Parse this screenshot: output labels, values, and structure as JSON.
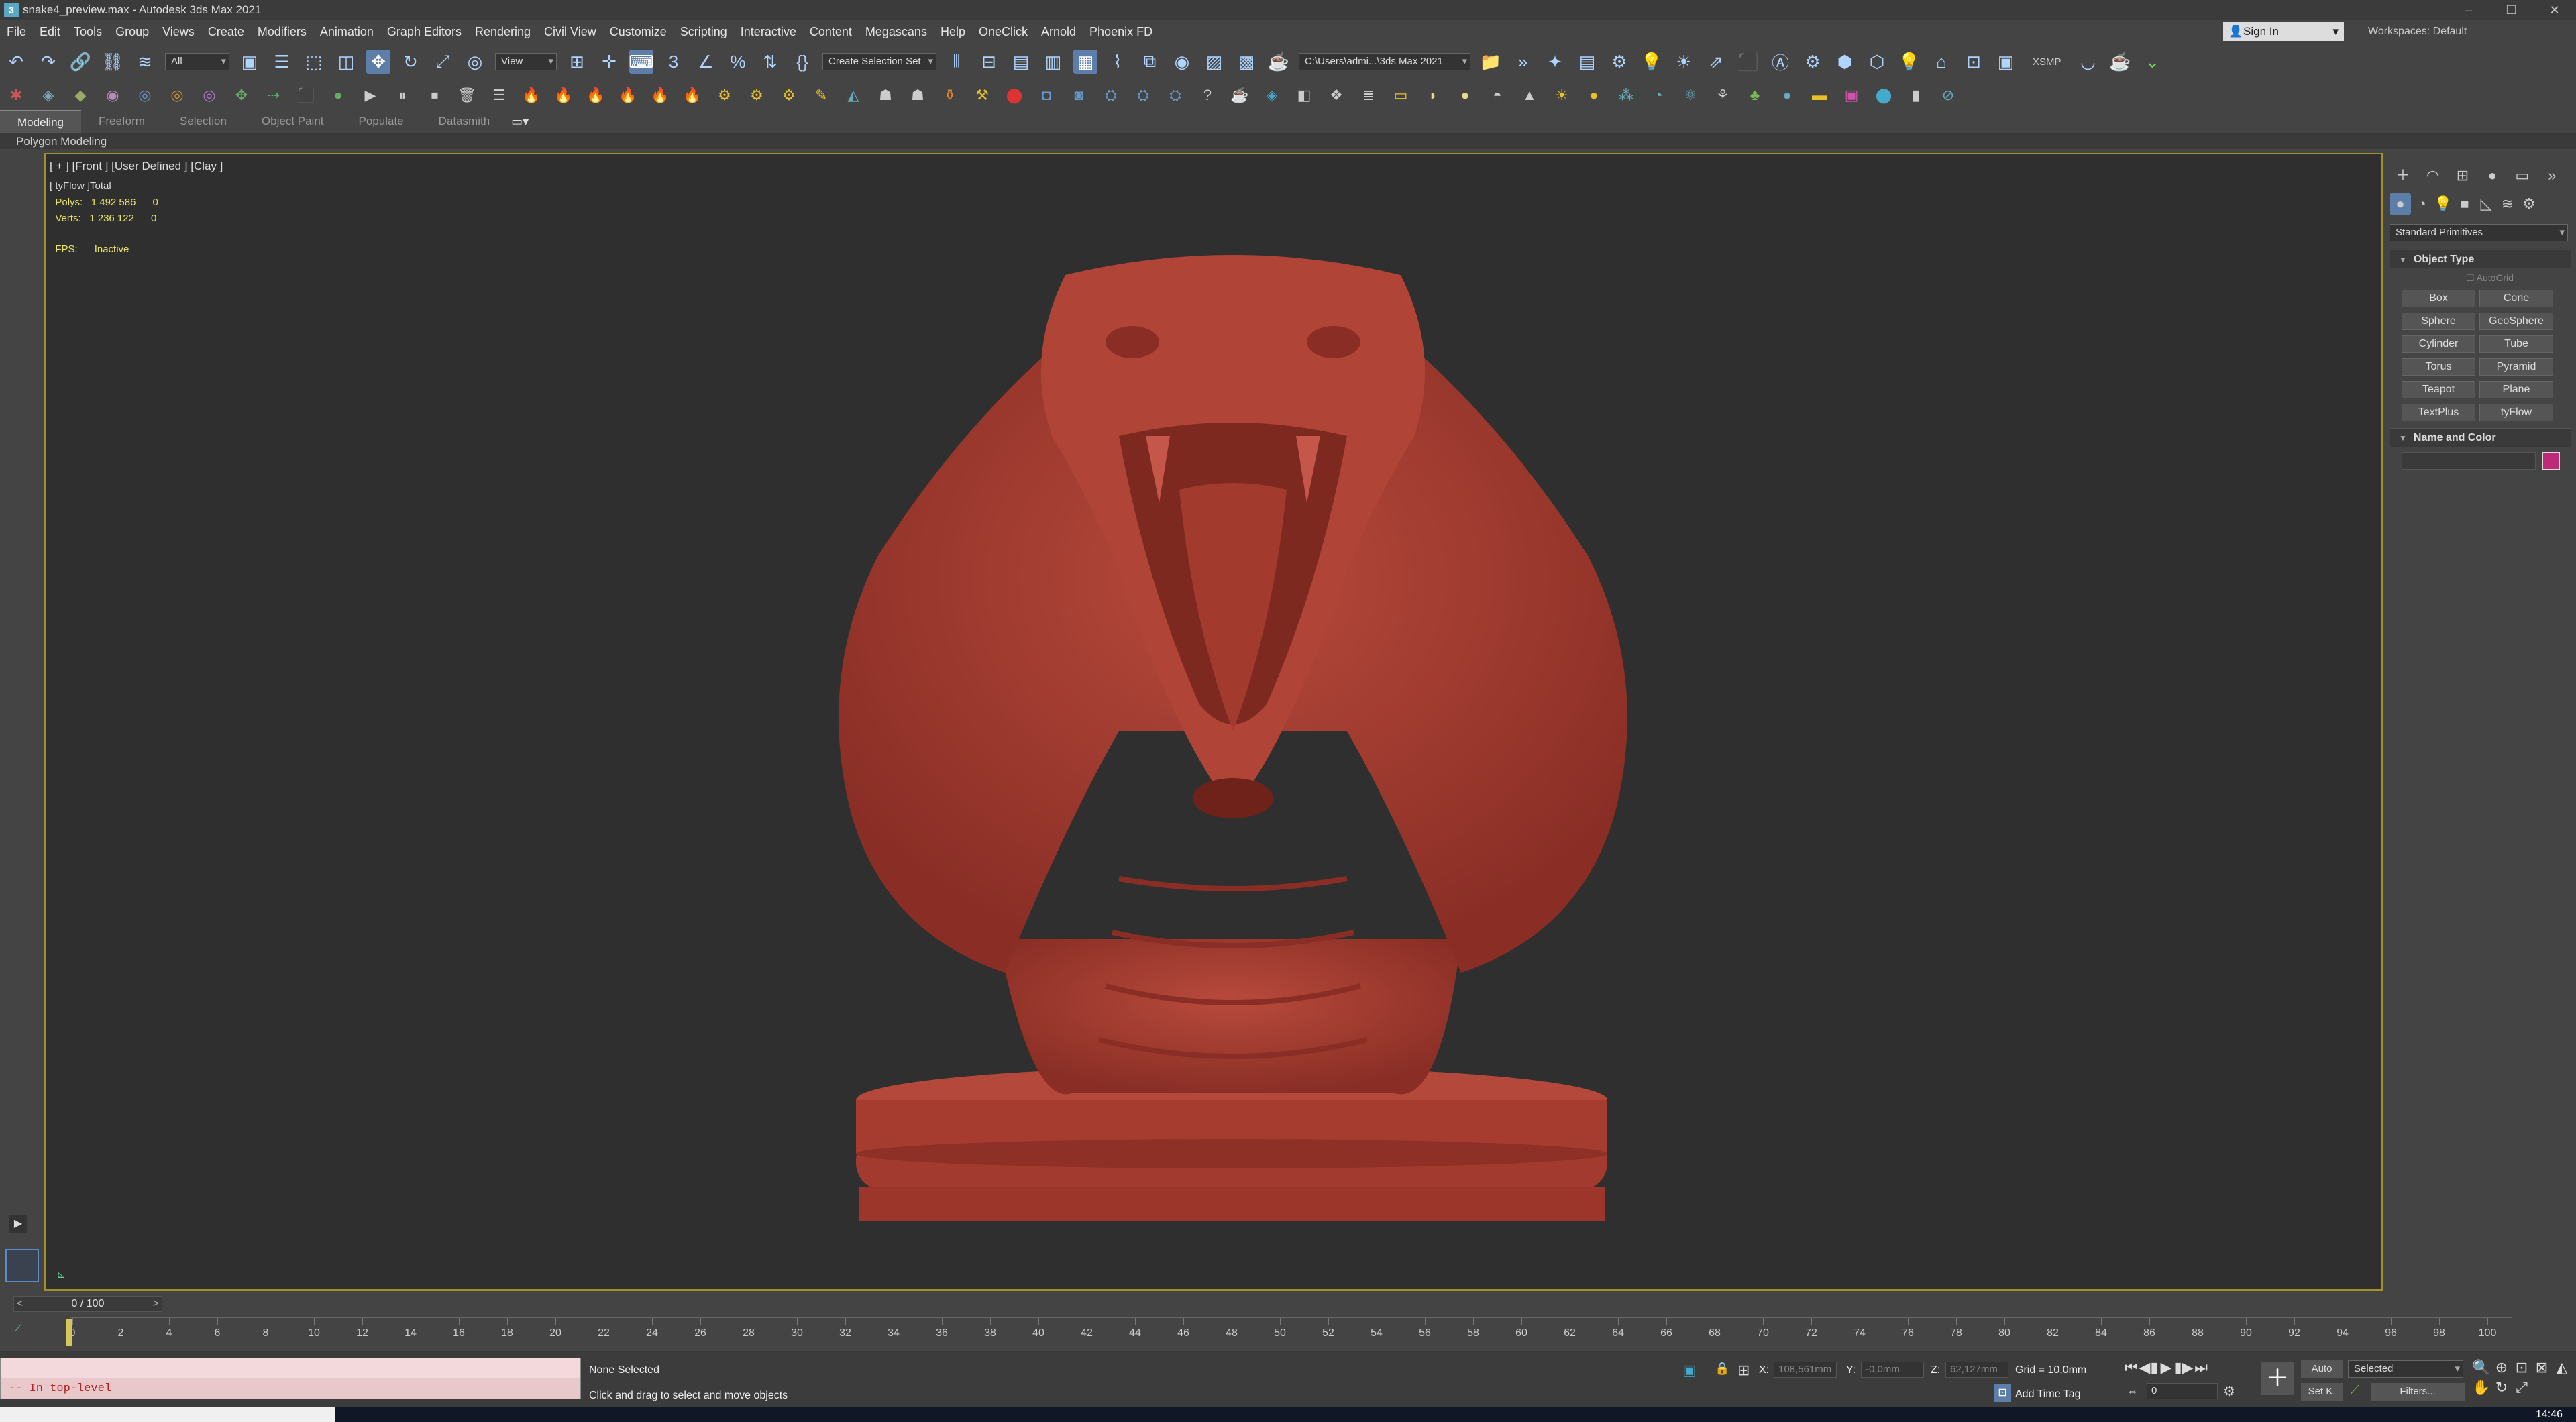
{
  "window": {
    "title": "snake4_preview.max - Autodesk 3ds Max 2021",
    "controls": [
      "–",
      "❐",
      "✕"
    ]
  },
  "menu": [
    "File",
    "Edit",
    "Tools",
    "Group",
    "Views",
    "Create",
    "Modifiers",
    "Animation",
    "Graph Editors",
    "Rendering",
    "Civil View",
    "Customize",
    "Scripting",
    "Interactive",
    "Content",
    "Megascans",
    "Help",
    "OneClick",
    "Arnold",
    "Phoenix FD"
  ],
  "account": {
    "signin": "Sign In",
    "workspaces_label": "Workspaces: Default"
  },
  "toolbar": {
    "filter": "All",
    "ref_coord": "View",
    "selection_set": "Create Selection Set",
    "path": "C:\\Users\\admi...\\3ds Max 2021",
    "xsmp": "XSMP"
  },
  "ribbon": {
    "tabs": [
      "Modeling",
      "Freeform",
      "Selection",
      "Object Paint",
      "Populate",
      "Datasmith"
    ],
    "active": "Modeling",
    "panel": "Polygon Modeling"
  },
  "viewport": {
    "label": "[ + ] [Front ] [User Defined ] [Clay ]",
    "stats_header": "[ tyFlow ]Total",
    "polys_label": "Polys:",
    "polys_value": "1 492 586",
    "polys_sel": "0",
    "verts_label": "Verts:",
    "verts_value": "1 236 122",
    "verts_sel": "0",
    "fps_label": "FPS:",
    "fps_value": "Inactive",
    "model_color": "#a33a2f"
  },
  "command_panel": {
    "category": "Standard Primitives",
    "object_type_title": "Object Type",
    "autogrid": "AutoGrid",
    "buttons": [
      "Box",
      "Cone",
      "Sphere",
      "GeoSphere",
      "Cylinder",
      "Tube",
      "Torus",
      "Pyramid",
      "Teapot",
      "Plane",
      "TextPlus",
      "tyFlow"
    ],
    "name_color_title": "Name and Color",
    "swatch_color": "#c0287a"
  },
  "timeline": {
    "frame": "0 / 100",
    "ticks": [
      "0",
      "2",
      "4",
      "6",
      "8",
      "10",
      "12",
      "14",
      "16",
      "18",
      "20",
      "22",
      "24",
      "26",
      "28",
      "30",
      "32",
      "34",
      "36",
      "38",
      "40",
      "42",
      "44",
      "46",
      "48",
      "50",
      "52",
      "54",
      "56",
      "58",
      "60",
      "62",
      "64",
      "66",
      "68",
      "70",
      "72",
      "74",
      "76",
      "78",
      "80",
      "82",
      "84",
      "86",
      "88",
      "90",
      "92",
      "94",
      "96",
      "98",
      "100"
    ]
  },
  "status": {
    "maxscript": "-- In top-level",
    "selection": "None Selected",
    "prompt": "Click and drag to select and move objects",
    "x_label": "X:",
    "x_value": "108,561mm",
    "y_label": "Y:",
    "y_value": "-0,0mm",
    "z_label": "Z:",
    "z_value": "62,127mm",
    "grid": "Grid = 10,0mm",
    "add_time_tag": "Add Time Tag",
    "auto": "Auto",
    "selected": "Selected",
    "setk": "Set K.",
    "filters": "Filters...",
    "frame_field": "0",
    "clock": "14:46"
  }
}
